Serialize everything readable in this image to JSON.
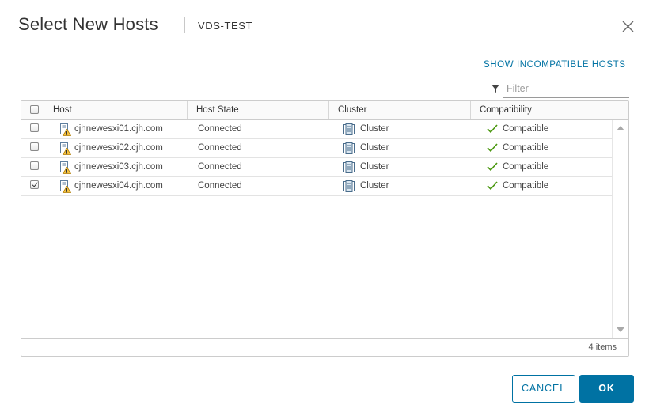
{
  "dialog": {
    "title": "Select New Hosts",
    "subtitle": "VDS-TEST"
  },
  "toolbar": {
    "show_incompatible_label": "SHOW INCOMPATIBLE HOSTS",
    "filter_placeholder": "Filter",
    "filter_value": ""
  },
  "table": {
    "columns": [
      "Host",
      "Host State",
      "Cluster",
      "Compatibility"
    ],
    "rows": [
      {
        "checked": false,
        "host": "cjhnewesxi01.cjh.com",
        "state": "Connected",
        "cluster": "Cluster",
        "compatibility": "Compatible"
      },
      {
        "checked": false,
        "host": "cjhnewesxi02.cjh.com",
        "state": "Connected",
        "cluster": "Cluster",
        "compatibility": "Compatible"
      },
      {
        "checked": false,
        "host": "cjhnewesxi03.cjh.com",
        "state": "Connected",
        "cluster": "Cluster",
        "compatibility": "Compatible"
      },
      {
        "checked": true,
        "host": "cjhnewesxi04.cjh.com",
        "state": "Connected",
        "cluster": "Cluster",
        "compatibility": "Compatible"
      }
    ],
    "footer_count": "4 items"
  },
  "buttons": {
    "cancel_label": "CANCEL",
    "ok_label": "OK"
  },
  "colors": {
    "accent": "#0072a3",
    "compatible_check": "#48960c",
    "warning": "#f5a623"
  },
  "icons": {
    "close": "close-icon",
    "filter": "filter-icon",
    "host": "host-warning-icon",
    "cluster": "cluster-icon",
    "compatible": "checkmark-icon"
  }
}
